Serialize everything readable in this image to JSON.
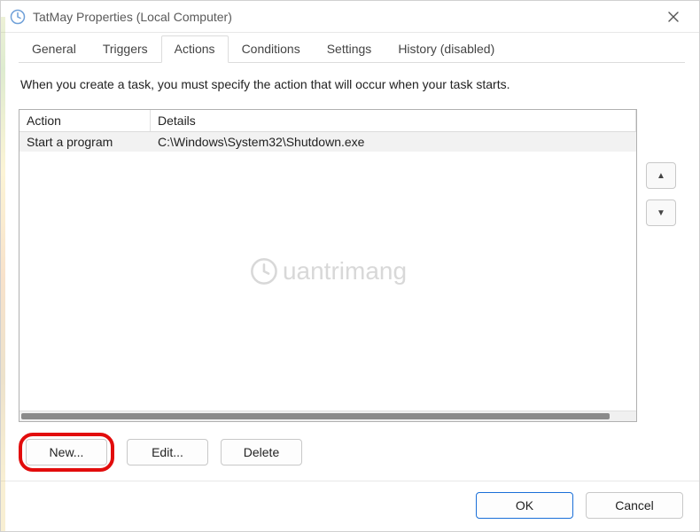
{
  "window": {
    "title": "TatMay Properties (Local Computer)"
  },
  "tabs": {
    "items": [
      {
        "label": "General"
      },
      {
        "label": "Triggers"
      },
      {
        "label": "Actions"
      },
      {
        "label": "Conditions"
      },
      {
        "label": "Settings"
      },
      {
        "label": "History (disabled)"
      }
    ],
    "active_index": 2
  },
  "description": "When you create a task, you must specify the action that will occur when your task starts.",
  "columns": {
    "action": "Action",
    "details": "Details"
  },
  "rows": [
    {
      "action": "Start a program",
      "details": "C:\\Windows\\System32\\Shutdown.exe"
    }
  ],
  "buttons": {
    "new": "New...",
    "edit": "Edit...",
    "delete": "Delete",
    "ok": "OK",
    "cancel": "Cancel"
  },
  "watermark": "uantrimang"
}
